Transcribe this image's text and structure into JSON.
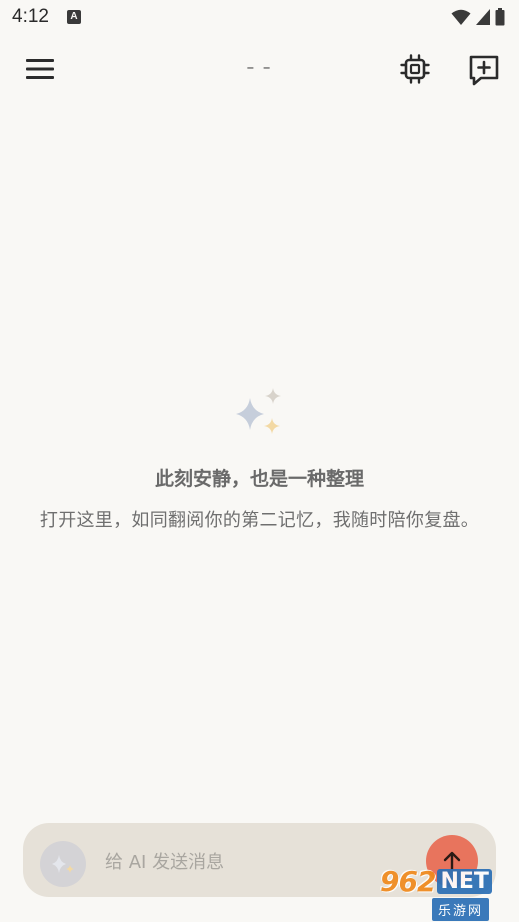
{
  "status_bar": {
    "time": "4:12",
    "app_icon_letter": "A"
  },
  "app_bar": {
    "title": "– –"
  },
  "empty_state": {
    "title": "此刻安静，也是一种整理",
    "subtitle": "打开这里，如同翻阅你的第二记忆，我随时陪你复盘。"
  },
  "composer": {
    "placeholder": "给 AI 发送消息",
    "value": ""
  },
  "watermark": {
    "brand_number": "962",
    "brand_suffix": "NET",
    "brand_cn": "乐游网"
  },
  "colors": {
    "background": "#f9f8f5",
    "composer_bg": "#e6e1d8",
    "send_button": "#e8745d",
    "sparkle_blue": "#c6cedb",
    "sparkle_gold": "#f3d9a4",
    "sparkle_gray": "#d8d3cb"
  },
  "icons": {
    "menu": "hamburger-menu-icon",
    "chip": "chip-icon",
    "new_chat": "add-chat-icon",
    "sparkle": "sparkle-icon",
    "send": "arrow-up-icon",
    "wifi": "wifi-icon",
    "signal": "signal-icon",
    "battery": "battery-icon"
  }
}
